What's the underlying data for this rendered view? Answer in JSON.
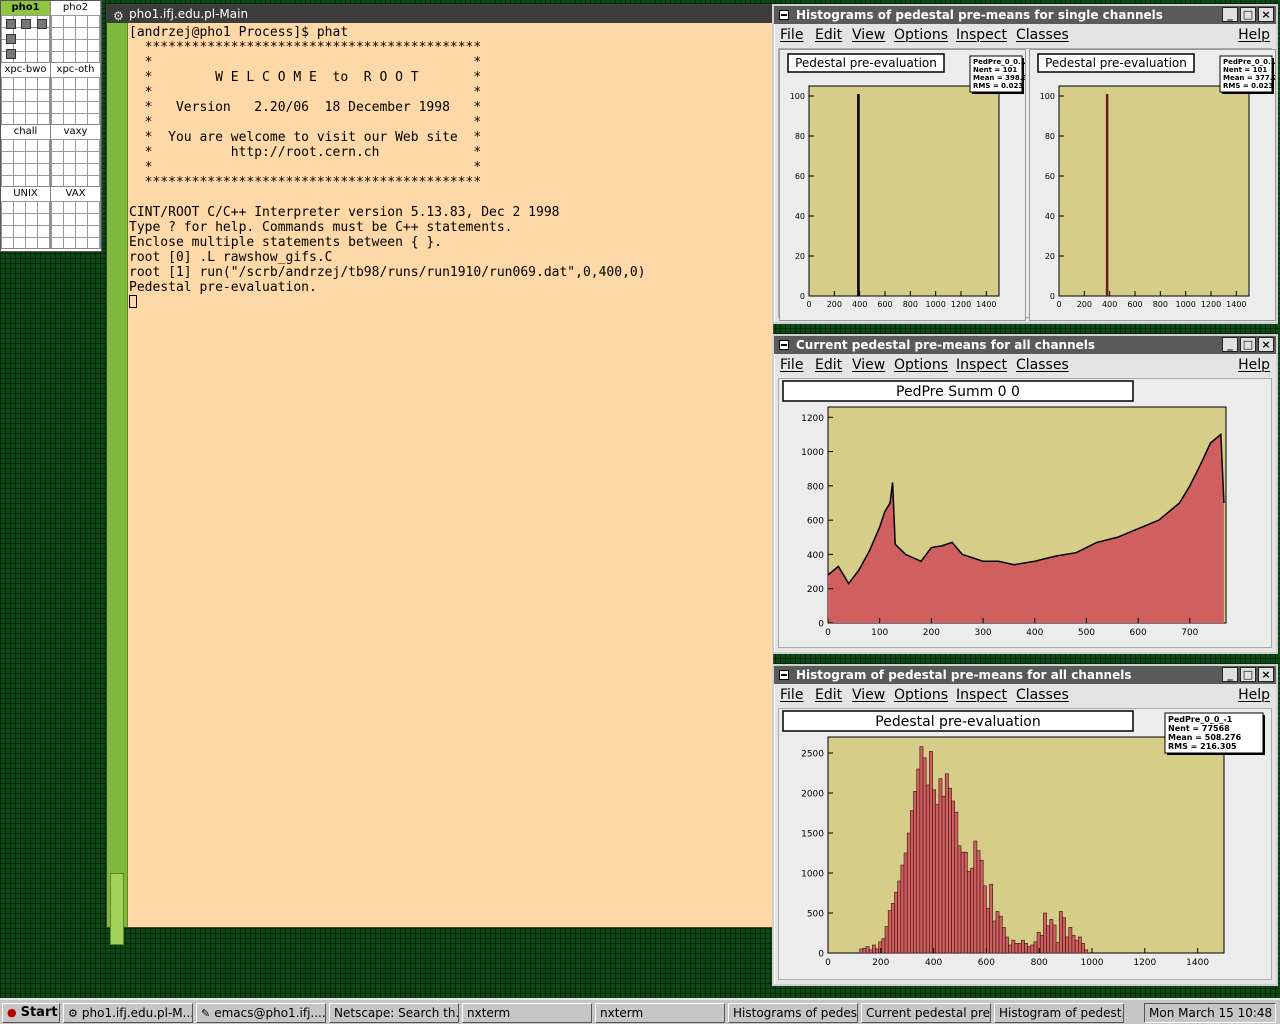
{
  "pager": {
    "desktops": [
      {
        "label": "pho1",
        "active": true
      },
      {
        "label": "pho2",
        "active": false
      },
      {
        "label": "xpc-bwo",
        "active": false
      },
      {
        "label": "xpc-oth",
        "active": false
      },
      {
        "label": "chall",
        "active": false
      },
      {
        "label": "vaxy",
        "active": false
      },
      {
        "label": "UNIX",
        "active": false
      },
      {
        "label": "VAX",
        "active": false
      }
    ]
  },
  "terminal": {
    "title": "pho1.ifj.edu.pl-Main",
    "icon": "terminal-icon",
    "background": "#fed9a7",
    "lines": [
      "[andrzej@pho1 Process]$ phat",
      "  *******************************************",
      "  *                                         *",
      "  *        W E L C O M E  to  R O O T       *",
      "  *                                         *",
      "  *   Version   2.20/06  18 December 1998   *",
      "  *                                         *",
      "  *  You are welcome to visit our Web site  *",
      "  *          http://root.cern.ch            *",
      "  *                                         *",
      "  *******************************************",
      "",
      "CINT/ROOT C/C++ Interpreter version 5.13.83, Dec 2 1998",
      "Type ? for help. Commands must be C++ statements.",
      "Enclose multiple statements between { }.",
      "root [0] .L rawshow_gifs.C",
      "root [1] run(\"/scrb/andrzej/tb98/runs/run1910/run069.dat\",0,400,0)",
      "Pedestal pre-evaluation."
    ]
  },
  "menu": {
    "file": "File",
    "edit": "Edit",
    "view": "View",
    "options": "Options",
    "inspect": "Inspect",
    "classes": "Classes",
    "help": "Help"
  },
  "windows": {
    "single": {
      "title": "Histograms of pedestal pre-means for single channels",
      "pads": [
        {
          "title": "Pedestal pre-evaluation",
          "stats": [
            "PedPre_0_0...",
            "Nent = 101",
            "Mean = 398.3",
            "RMS = 0.023"
          ]
        },
        {
          "title": "Pedestal pre-evaluation",
          "stats": [
            "PedPre_0_0...",
            "Nent = 101",
            "Mean = 377.2",
            "RMS = 0.023"
          ]
        }
      ]
    },
    "current": {
      "title": "Current pedestal pre-means for all channels",
      "pad_title": "PedPre Summ 0 0"
    },
    "histogram": {
      "title": "Histogram of pedestal pre-means for all channels",
      "pad_title": "Pedestal pre-evaluation",
      "stats": [
        "PedPre_0_0_-1",
        "Nent = 77568",
        "Mean = 508.276",
        "RMS = 216.305"
      ]
    }
  },
  "chart_data": [
    {
      "type": "bar",
      "title": "Pedestal pre-evaluation",
      "x": [
        390
      ],
      "values": [
        101
      ],
      "xlim": [
        0,
        1500
      ],
      "ylim": [
        0,
        105
      ],
      "xticks": [
        0,
        200,
        400,
        600,
        800,
        1000,
        1200,
        1400
      ],
      "yticks": [
        0,
        20,
        40,
        60,
        80,
        100
      ],
      "colors": {
        "frame": "#d5cd88",
        "bar": "#000000"
      }
    },
    {
      "type": "bar",
      "title": "Pedestal pre-evaluation",
      "x": [
        380
      ],
      "values": [
        101
      ],
      "xlim": [
        0,
        1500
      ],
      "ylim": [
        0,
        105
      ],
      "xticks": [
        0,
        200,
        400,
        600,
        800,
        1000,
        1200,
        1400
      ],
      "yticks": [
        0,
        20,
        40,
        60,
        80,
        100
      ],
      "colors": {
        "frame": "#d5cd88",
        "bar": "#6b1b1b"
      }
    },
    {
      "type": "area",
      "title": "PedPre Summ 0 0",
      "x": [
        0,
        20,
        40,
        60,
        80,
        100,
        110,
        120,
        125,
        130,
        150,
        180,
        200,
        220,
        240,
        260,
        280,
        300,
        330,
        360,
        400,
        440,
        480,
        520,
        560,
        600,
        640,
        660,
        680,
        700,
        720,
        740,
        760,
        766
      ],
      "values": [
        280,
        330,
        230,
        310,
        420,
        560,
        650,
        700,
        820,
        460,
        400,
        360,
        440,
        450,
        470,
        400,
        380,
        360,
        360,
        340,
        360,
        390,
        410,
        470,
        500,
        550,
        600,
        650,
        700,
        800,
        920,
        1050,
        1100,
        700
      ],
      "xlim": [
        0,
        770
      ],
      "ylim": [
        0,
        1260
      ],
      "xticks": [
        0,
        100,
        200,
        300,
        400,
        500,
        600,
        700
      ],
      "yticks": [
        0,
        200,
        400,
        600,
        800,
        1000,
        1200
      ],
      "colors": {
        "frame": "#d5cd88",
        "fill": "#d06060",
        "line": "#000000"
      }
    },
    {
      "type": "bar",
      "title": "Pedestal pre-evaluation",
      "x_start": 0,
      "bin_width": 12,
      "values": [
        0,
        0,
        0,
        0,
        0,
        0,
        0,
        0,
        0,
        0,
        50,
        60,
        80,
        40,
        100,
        50,
        140,
        180,
        330,
        530,
        620,
        760,
        900,
        1100,
        1250,
        1500,
        1780,
        2020,
        2300,
        2580,
        2440,
        2100,
        2520,
        2040,
        1860,
        2180,
        1960,
        2240,
        2060,
        1900,
        1760,
        1340,
        1260,
        1260,
        1020,
        1060,
        1400,
        1280,
        1160,
        840,
        560,
        860,
        400,
        520,
        460,
        320,
        200,
        100,
        160,
        120,
        120,
        160,
        120,
        80,
        100,
        140,
        260,
        220,
        500,
        340,
        420,
        350,
        130,
        520,
        440,
        200,
        320,
        220,
        160,
        200,
        120,
        40,
        0
      ],
      "xlim": [
        0,
        1500
      ],
      "ylim": [
        0,
        2700
      ],
      "xticks": [
        0,
        200,
        400,
        600,
        800,
        1000,
        1200,
        1400
      ],
      "yticks": [
        0,
        500,
        1000,
        1500,
        2000,
        2500
      ],
      "colors": {
        "frame": "#d5cd88",
        "fill": "#d06060",
        "line": "#3a1010"
      }
    }
  ],
  "taskbar": {
    "start": "Start",
    "items": [
      {
        "label": "pho1.ifj.edu.pl-M...",
        "icon": "terminal-icon"
      },
      {
        "label": "emacs@pho1.ifj....",
        "icon": "editor-icon"
      },
      {
        "label": "Netscape: Search th...",
        "icon": ""
      },
      {
        "label": "nxterm",
        "icon": ""
      },
      {
        "label": "nxterm",
        "icon": ""
      },
      {
        "label": "Histograms of pedes...",
        "icon": ""
      },
      {
        "label": "Current pedestal pre...",
        "icon": ""
      },
      {
        "label": "Histogram of pedest...",
        "icon": ""
      }
    ],
    "clock": "Mon March 15 10:48"
  }
}
